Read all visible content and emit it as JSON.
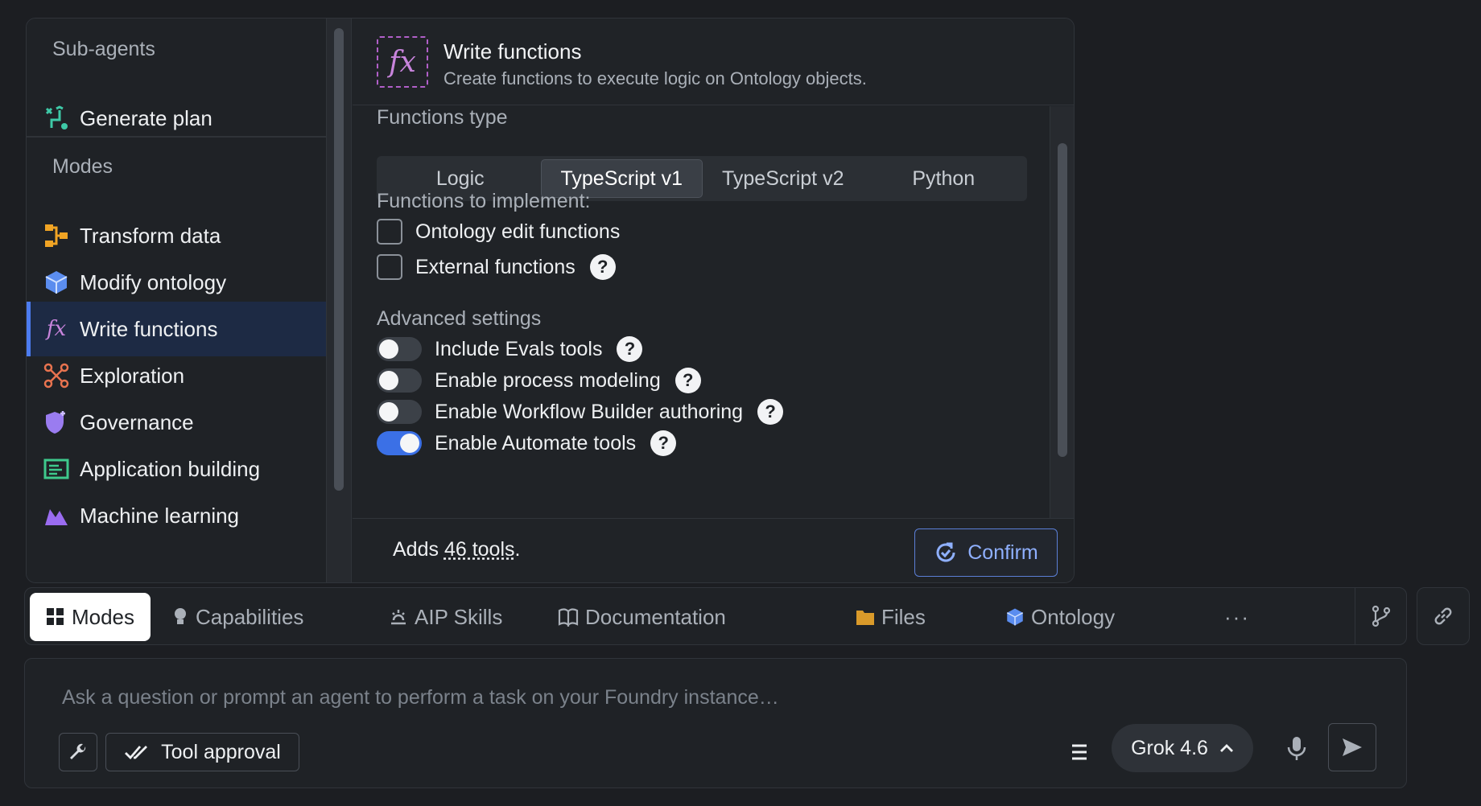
{
  "sidebar": {
    "subagents_title": "Sub-agents",
    "subagents": [
      {
        "label": "Generate plan",
        "icon": "plan-icon",
        "color": "#3ec9a7"
      }
    ],
    "modes_title": "Modes",
    "modes": [
      {
        "label": "Transform data",
        "icon": "transform-icon",
        "color": "#f0a424"
      },
      {
        "label": "Modify ontology",
        "icon": "cube-icon",
        "color": "#5b8def"
      },
      {
        "label": "Write functions",
        "icon": "fx-icon",
        "color": "#c884dc",
        "active": true
      },
      {
        "label": "Exploration",
        "icon": "exploration-icon",
        "color": "#e8734f"
      },
      {
        "label": "Governance",
        "icon": "shield-icon",
        "color": "#9a7cf0"
      },
      {
        "label": "Application building",
        "icon": "app-icon",
        "color": "#3ec98c"
      },
      {
        "label": "Machine learning",
        "icon": "ml-icon",
        "color": "#9a6cf0"
      }
    ]
  },
  "detail": {
    "icon_text": "fx",
    "title": "Write functions",
    "subtitle": "Create functions to execute logic on Ontology objects.",
    "functions_type_label": "Functions type",
    "functions_types": [
      "Logic",
      "TypeScript v1",
      "TypeScript v2",
      "Python"
    ],
    "selected_type": "TypeScript v1",
    "implement_label": "Functions to implement:",
    "implement_options": [
      {
        "label": "Ontology edit functions",
        "checked": false,
        "help": false
      },
      {
        "label": "External functions",
        "checked": false,
        "help": true
      }
    ],
    "advanced_label": "Advanced settings",
    "advanced": [
      {
        "label": "Include Evals tools",
        "on": false
      },
      {
        "label": "Enable process modeling",
        "on": false
      },
      {
        "label": "Enable Workflow Builder authoring",
        "on": false
      },
      {
        "label": "Enable Automate tools",
        "on": true
      }
    ],
    "adds_prefix": "Adds ",
    "adds_count": "46 tools",
    "adds_suffix": ".",
    "confirm_label": "Confirm",
    "help_glyph": "?"
  },
  "tabs": [
    {
      "label": "Modes",
      "icon": "grid-icon",
      "selected": true
    },
    {
      "label": "Capabilities",
      "icon": "lightbulb-icon"
    },
    {
      "label": "AIP Skills",
      "icon": "skills-icon"
    },
    {
      "label": "Documentation",
      "icon": "book-icon"
    },
    {
      "label": "Files",
      "icon": "folder-icon"
    },
    {
      "label": "Ontology",
      "icon": "ontology-icon"
    }
  ],
  "more_label": "···",
  "prompt": {
    "placeholder": "Ask a question or prompt an agent to perform a task on your Foundry instance…",
    "tool_approval_label": "Tool approval",
    "model_label": "Grok 4.6"
  },
  "colors": {
    "accent": "#3b70e6",
    "confirm": "#8fb0ff",
    "active_bg": "#1d2a44"
  }
}
